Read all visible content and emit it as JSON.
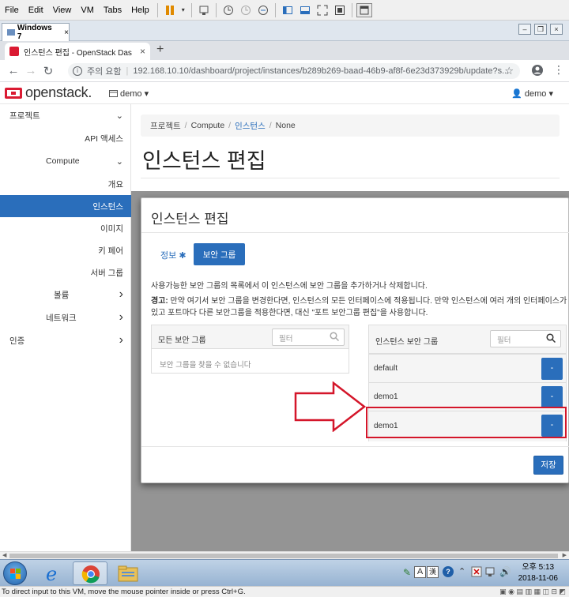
{
  "vm_menu": [
    "File",
    "Edit",
    "View",
    "VM",
    "Tabs",
    "Help"
  ],
  "vm_tab": {
    "label": "Windows 7"
  },
  "browser": {
    "tab_title": "인스턴스 편집 - OpenStack Das",
    "security_label": "주의 요함",
    "url": "192.168.10.10/dashboard/project/instances/b289b269-baad-46b9-af8f-6e23d373929b/update?s..."
  },
  "topnav": {
    "logo": "openstack.",
    "project": "demo ▾",
    "user": "demo ▾"
  },
  "sidebar": {
    "items": [
      {
        "label": "프로젝트",
        "chev": "⌄"
      },
      {
        "label": "API 액세스",
        "chev": ""
      },
      {
        "label": "Compute",
        "chev": "⌄"
      },
      {
        "label": "개요",
        "chev": ""
      },
      {
        "label": "인스턴스",
        "chev": ""
      },
      {
        "label": "이미지",
        "chev": ""
      },
      {
        "label": "키 페어",
        "chev": ""
      },
      {
        "label": "서버 그룹",
        "chev": ""
      },
      {
        "label": "볼륨",
        "chev": "›"
      },
      {
        "label": "네트워크",
        "chev": "›"
      },
      {
        "label": "인증",
        "chev": "›"
      }
    ]
  },
  "breadcrumb": {
    "items": [
      "프로젝트",
      "Compute",
      "인스턴스",
      "None"
    ]
  },
  "page_title": "인스턴스 편집",
  "modal": {
    "title": "인스턴스 편집",
    "tab_info": "정보",
    "tab_info_required": "✱",
    "tab_security": "보안 그룹",
    "help_text": "사용가능한 보안 그룹의 목록에서 이 인스턴스에 보안 그룹을 추가하거나 삭제합니다.",
    "warning_label": "경고:",
    "warning_text": " 만약 여기서 보안 그룹을 변경한다면, 인스턴스의 모든 인터페이스에 적용됩니다. 만약 인스턴스에 여러 개의 인터페이스가 있고 포트마다 다른 보안그룹을 적용한다면, 대신 \"포트 보안그룹 편집\"을 사용합니다.",
    "all_groups": {
      "title": "모든 보안 그룹",
      "filter_placeholder": "필터",
      "empty": "보안 그룹을 찾을 수 없습니다"
    },
    "instance_groups": {
      "title": "인스턴스 보안 그룹",
      "filter_placeholder": "필터",
      "rows": [
        {
          "name": "default",
          "btn": "-"
        },
        {
          "name": "demo1",
          "btn": "-"
        },
        {
          "name": "demo1",
          "btn": "-"
        }
      ]
    },
    "save_label": "저장"
  },
  "taskbar": {
    "lang": "A",
    "hanja": "漢",
    "time": "오후 5:13",
    "date": "2018-11-06"
  },
  "statusbar": "To direct input to this VM, move the mouse pointer inside or press Ctrl+G.",
  "colors": {
    "accent": "#2a6ebb",
    "brand": "#da1a32",
    "highlight": "#d4162a"
  }
}
